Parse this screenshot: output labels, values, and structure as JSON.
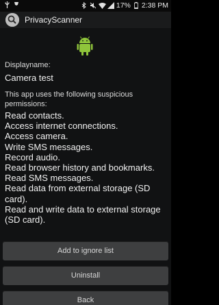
{
  "status_bar": {
    "battery_percent": "17%",
    "time": "2:38 PM",
    "icons": [
      "usb-icon",
      "pin-icon",
      "bluetooth-icon",
      "mute-icon",
      "wifi-icon",
      "signal-icon",
      "battery-icon"
    ]
  },
  "app_bar": {
    "title": "PrivacyScanner",
    "icon": "search-icon"
  },
  "details": {
    "displayname_label": "Displayname:",
    "app_name": "Camera test",
    "intro_text": "This app uses the following suspicious permissions:",
    "permissions": [
      "Read contacts.",
      "Access internet connections.",
      "Access camera.",
      "Write SMS messages.",
      "Record audio.",
      "Read browser history and bookmarks.",
      "Read SMS messages.",
      "Read data from external storage (SD card).",
      "Read and write data to external storage (SD card)."
    ]
  },
  "buttons": {
    "ignore": "Add to ignore list",
    "uninstall": "Uninstall",
    "back": "Back"
  },
  "colors": {
    "android_green": "#8fc43b",
    "background": "#111213",
    "button": "#3e3f40"
  }
}
